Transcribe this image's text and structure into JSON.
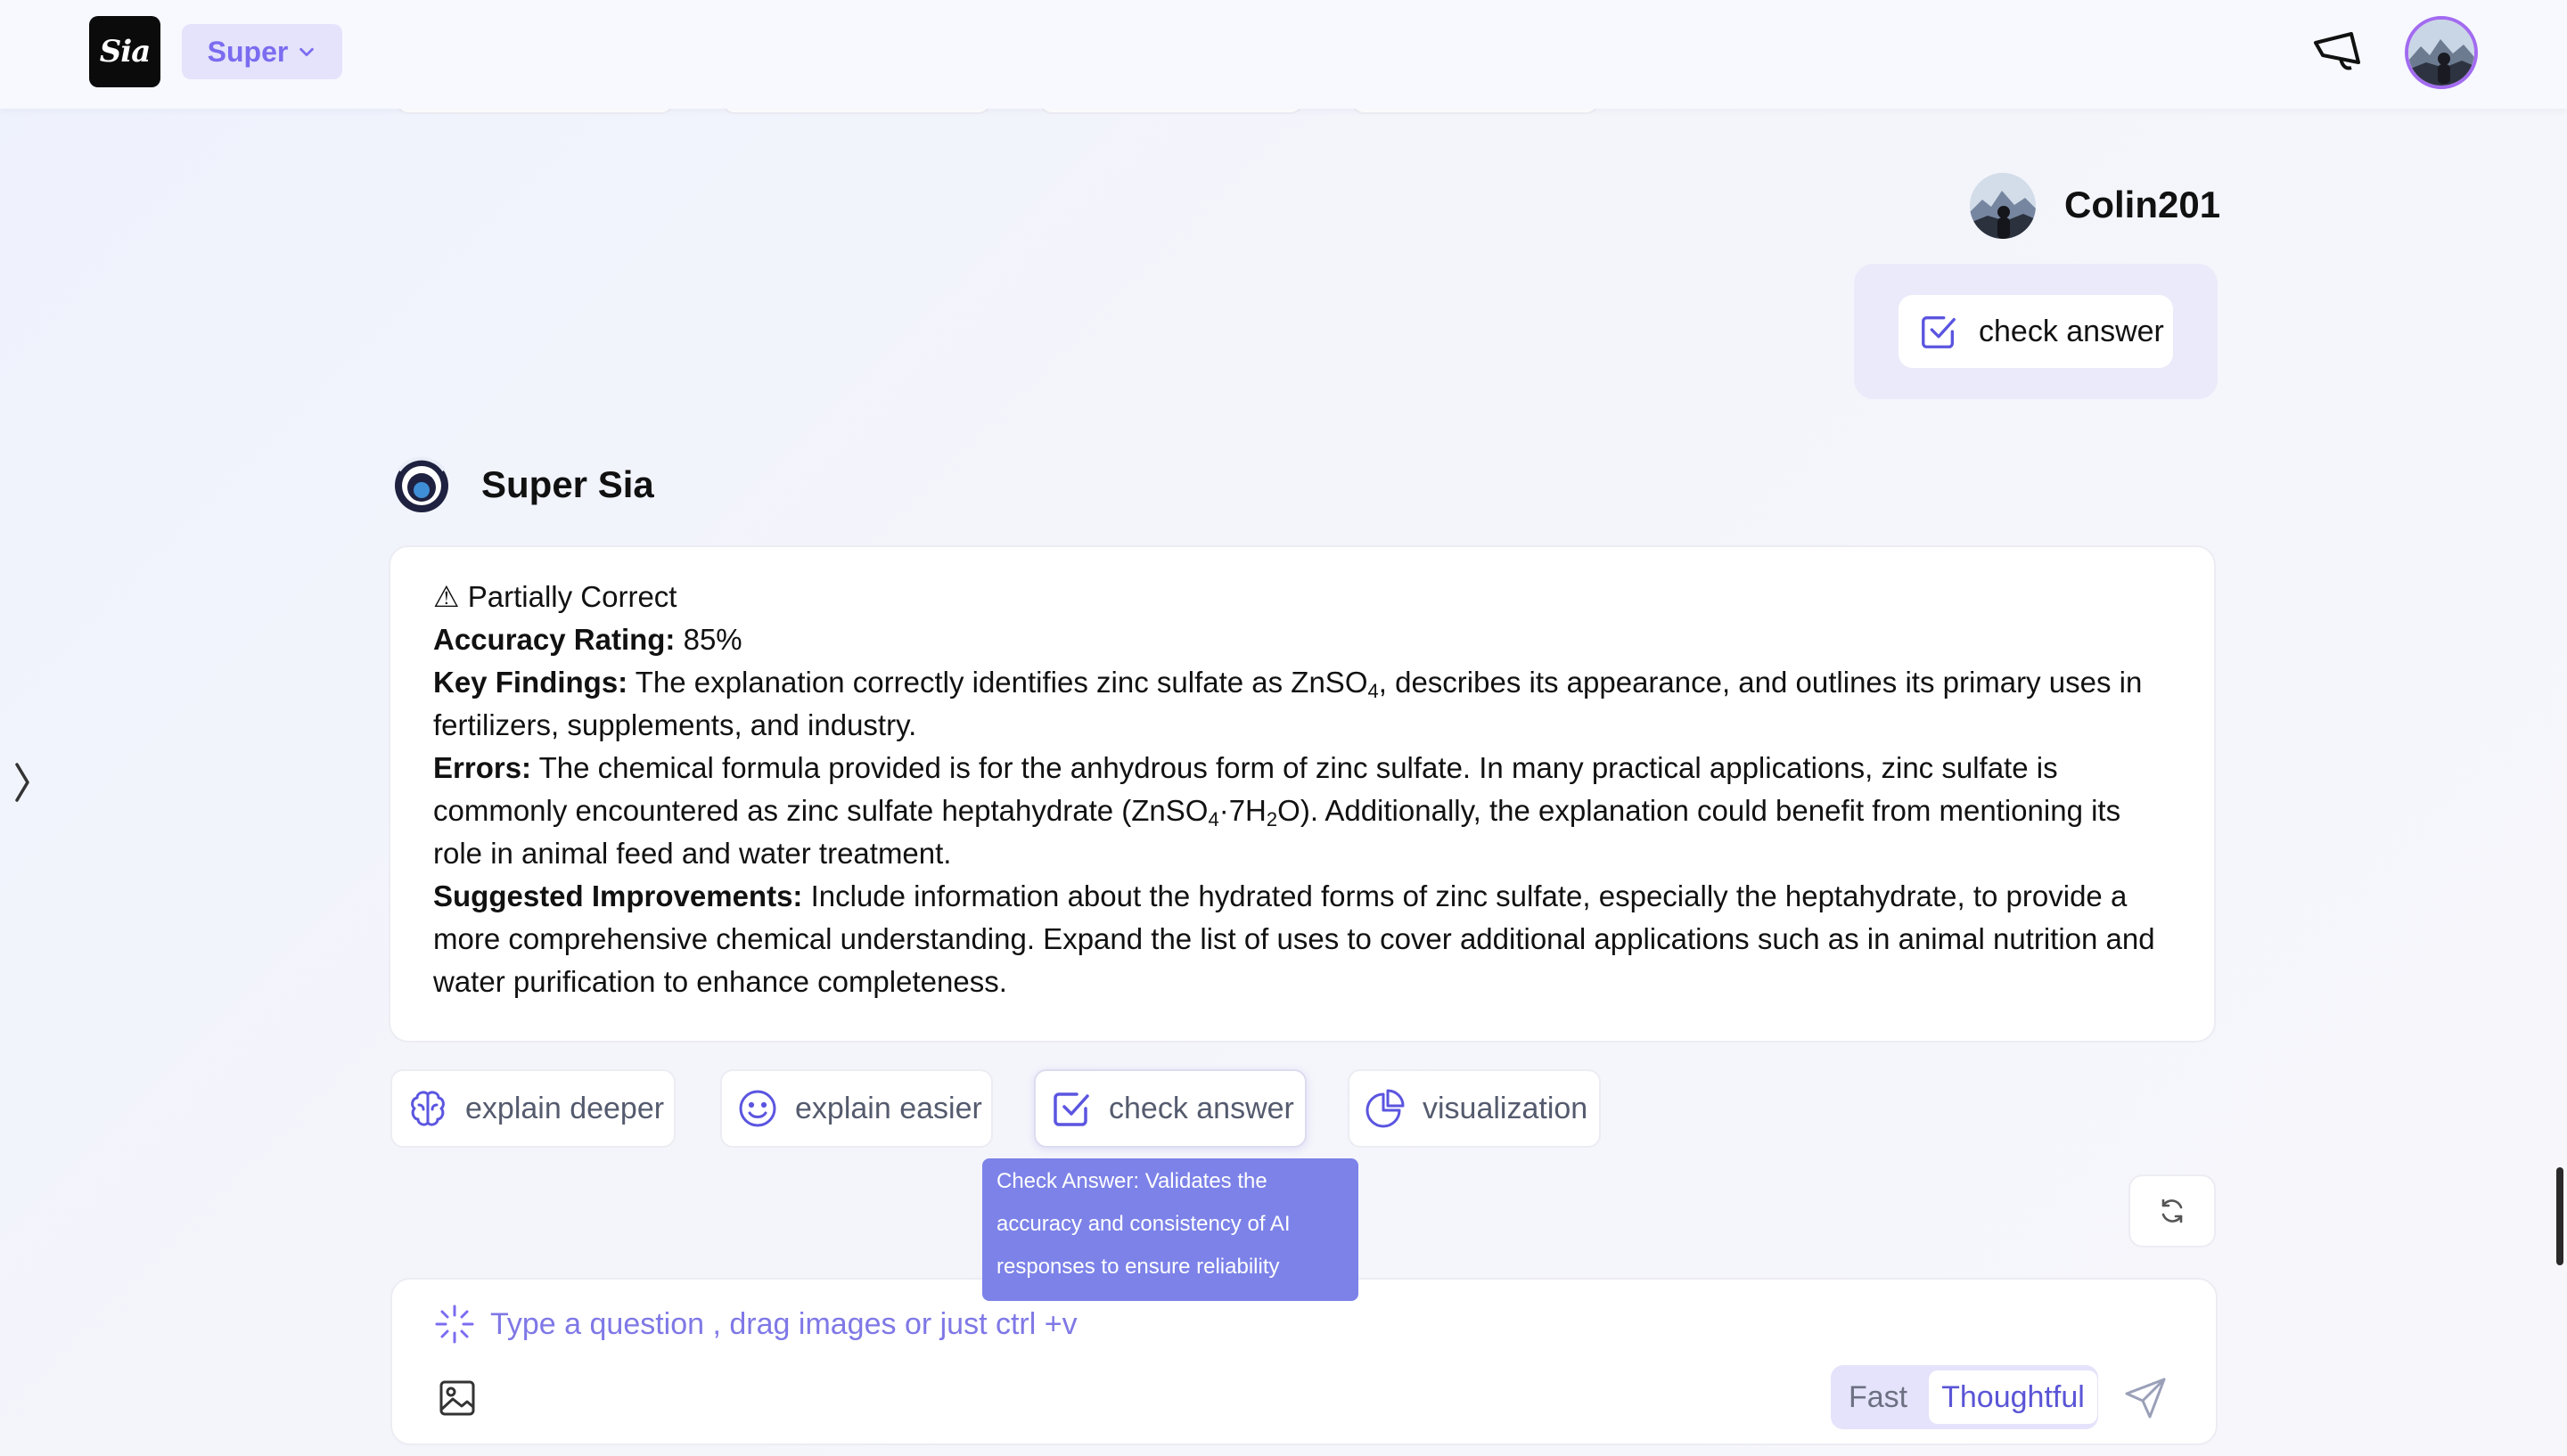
{
  "header": {
    "logo_text": "Sia",
    "mode_label": "Super"
  },
  "conversation": {
    "user": {
      "name": "Colin201",
      "message_chip": "check answer"
    },
    "assistant": {
      "name": "Super Sia",
      "status": "⚠ Partially Correct",
      "accuracy_label": "Accuracy Rating:",
      "accuracy_value": " 85%",
      "key_findings_label": "Key Findings:",
      "key_findings_pre": " The explanation correctly identifies zinc sulfate as ZnSO",
      "key_findings_sub": "4",
      "key_findings_post": ", describes its appearance, and outlines its primary uses in fertilizers, supplements, and industry.",
      "errors_label": "Errors:",
      "errors_pre": " The chemical formula provided is for the anhydrous form of zinc sulfate. In many practical applications, zinc sulfate is commonly encountered as zinc sulfate heptahydrate (ZnSO",
      "errors_sub1": "4",
      "errors_mid": "·7H",
      "errors_sub2": "2",
      "errors_post": "O). Additionally, the explanation could benefit from mentioning its role in animal feed and water treatment.",
      "improvements_label": "Suggested Improvements:",
      "improvements_text": " Include information about the hydrated forms of zinc sulfate, especially the heptahydrate, to provide a more comprehensive chemical understanding. Expand the list of uses to cover additional applications such as in animal nutrition and water purification to enhance completeness."
    }
  },
  "actions": [
    {
      "label": "explain deeper",
      "icon": "brain-icon"
    },
    {
      "label": "explain easier",
      "icon": "smiley-icon"
    },
    {
      "label": "check answer",
      "icon": "checkbox-icon"
    },
    {
      "label": "visualization",
      "icon": "pie-chart-icon"
    }
  ],
  "tooltip": {
    "text": "Check Answer: Validates the accuracy and consistency of AI responses to ensure reliability"
  },
  "input": {
    "placeholder": "Type a question , drag images or just ctrl +v",
    "speed_options": [
      "Fast",
      "Thoughtful"
    ],
    "selected_speed": "Thoughtful"
  },
  "colors": {
    "accent": "#7b6cf0",
    "tooltip_bg": "#7c82e8",
    "chip_bg": "#e4e3fb"
  }
}
